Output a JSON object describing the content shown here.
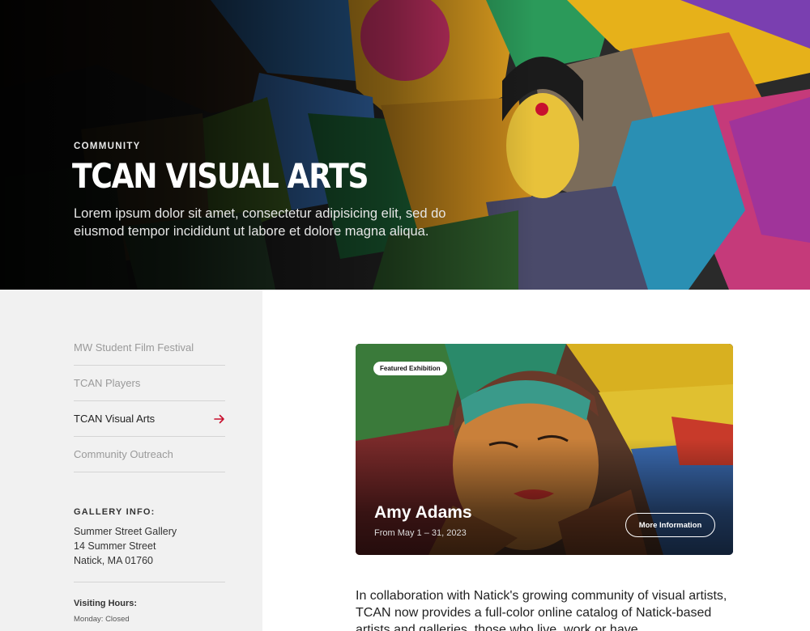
{
  "hero": {
    "eyebrow": "COMMUNITY",
    "title": "TCAN VISUAL ARTS",
    "subtitle": "Lorem ipsum dolor sit amet, consectetur adipisicing elit, sed do eiusmod tempor incididunt ut labore et dolore magna aliqua."
  },
  "sidebar": {
    "nav": [
      {
        "label": "MW Student Film Festival"
      },
      {
        "label": "TCAN Players"
      },
      {
        "label": "TCAN Visual Arts"
      },
      {
        "label": "Community Outreach"
      }
    ],
    "gallery_info": {
      "heading": "GALLERY INFO:",
      "name": "Summer Street Gallery",
      "street": "14 Summer Street",
      "city": "Natick, MA 01760"
    },
    "visiting": {
      "heading": "Visiting Hours:",
      "line1": "Monday: Closed"
    }
  },
  "feature": {
    "badge": "Featured Exhibition",
    "title": "Amy Adams",
    "date": "From May 1 – 31, 2023",
    "button": "More Information"
  },
  "body": {
    "intro": "In collaboration with Natick's growing community of visual artists, TCAN now provides a full-color online catalog of Natick-based artists and galleries, those who live, work or have"
  },
  "colors": {
    "accent": "#c8102e",
    "sidebar_bg": "#f1f1f1"
  }
}
